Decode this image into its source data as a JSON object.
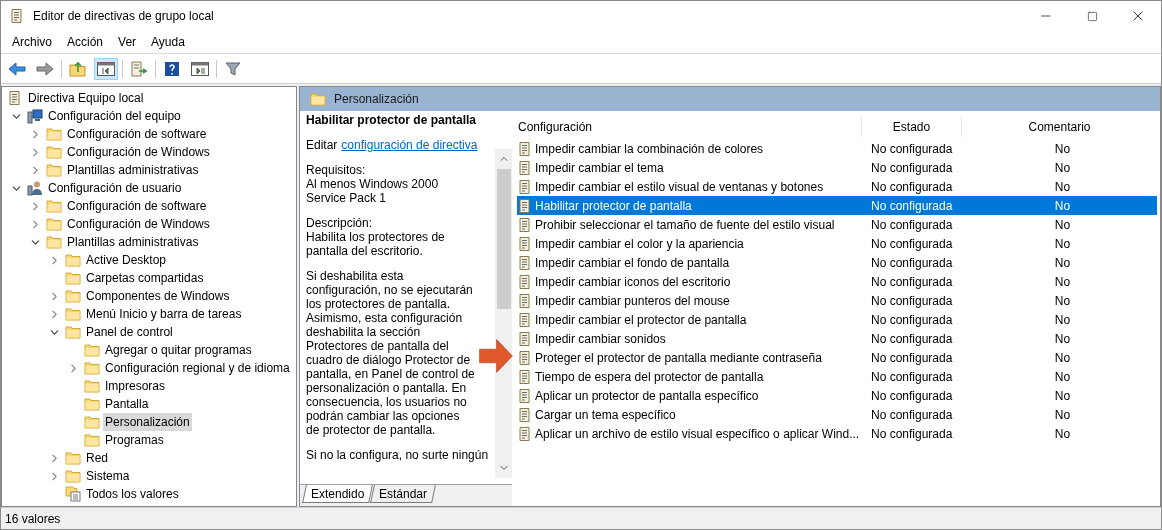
{
  "window": {
    "title": "Editor de directivas de grupo local"
  },
  "menu": [
    "Archivo",
    "Acción",
    "Ver",
    "Ayuda"
  ],
  "tree": [
    {
      "label": "Directiva Equipo local",
      "kind": "document",
      "selected": false,
      "children": [
        {
          "label": "Configuración del equipo",
          "kind": "computer",
          "expanded": true,
          "selected": false,
          "children": [
            {
              "label": "Configuración de software",
              "kind": "folder",
              "expanded": false,
              "selected": false
            },
            {
              "label": "Configuración de Windows",
              "kind": "folder",
              "expanded": false,
              "selected": false
            },
            {
              "label": "Plantillas administrativas",
              "kind": "folder",
              "expanded": false,
              "selected": false
            }
          ]
        },
        {
          "label": "Configuración de usuario",
          "kind": "user",
          "expanded": true,
          "selected": false,
          "children": [
            {
              "label": "Configuración de software",
              "kind": "folder",
              "expanded": false,
              "selected": false
            },
            {
              "label": "Configuración de Windows",
              "kind": "folder",
              "expanded": false,
              "selected": false
            },
            {
              "label": "Plantillas administrativas",
              "kind": "folder",
              "expanded": true,
              "selected": false,
              "children": [
                {
                  "label": "Active Desktop",
                  "kind": "folder",
                  "expanded": false,
                  "selected": false
                },
                {
                  "label": "Carpetas compartidas",
                  "kind": "folder",
                  "selected": false
                },
                {
                  "label": "Componentes de Windows",
                  "kind": "folder",
                  "expanded": false,
                  "selected": false
                },
                {
                  "label": "Menú Inicio y barra de tareas",
                  "kind": "folder",
                  "expanded": false,
                  "selected": false
                },
                {
                  "label": "Panel de control",
                  "kind": "folder",
                  "expanded": true,
                  "selected": false,
                  "children": [
                    {
                      "label": "Agregar o quitar programas",
                      "kind": "folder",
                      "selected": false
                    },
                    {
                      "label": "Configuración regional y de idioma",
                      "kind": "folder",
                      "expanded": false,
                      "selected": false
                    },
                    {
                      "label": "Impresoras",
                      "kind": "folder",
                      "selected": false
                    },
                    {
                      "label": "Pantalla",
                      "kind": "folder",
                      "selected": false
                    },
                    {
                      "label": "Personalización",
                      "kind": "folder",
                      "selected": true
                    },
                    {
                      "label": "Programas",
                      "kind": "folder",
                      "selected": false
                    }
                  ]
                },
                {
                  "label": "Red",
                  "kind": "folder",
                  "expanded": false,
                  "selected": false
                },
                {
                  "label": "Sistema",
                  "kind": "folder",
                  "expanded": false,
                  "selected": false
                },
                {
                  "label": "Todos los valores",
                  "kind": "all",
                  "selected": false
                }
              ]
            }
          ]
        }
      ]
    }
  ],
  "header": {
    "title": "Personalización"
  },
  "description": {
    "title": "Habilitar protector de pantalla",
    "edit_prefix": "Editar",
    "edit_link": "configuración de directiva",
    "paragraphs": [
      "Requisitos:\nAl menos Windows 2000 Service Pack 1",
      "Descripción:\nHabilita los protectores de pantalla del escritorio.",
      "Si deshabilita esta configuración, no se ejecutarán los protectores de pantalla. Asimismo, esta configuración deshabilita la sección Protectores de pantalla del cuadro de diálogo Protector de pantalla, en Panel de control de personalización o pantalla. En consecuencia, los usuarios no podrán cambiar las opciones de protector de pantalla.",
      "Si no la configura, no surte ningún"
    ]
  },
  "table": {
    "columns": [
      "Configuración",
      "Estado",
      "Comentario"
    ],
    "rows": [
      {
        "name": "Impedir cambiar la combinación de colores",
        "state": "No configurada",
        "comment": "No",
        "selected": false
      },
      {
        "name": "Impedir cambiar el tema",
        "state": "No configurada",
        "comment": "No",
        "selected": false
      },
      {
        "name": "Impedir cambiar el estilo visual de ventanas y botones",
        "state": "No configurada",
        "comment": "No",
        "selected": false
      },
      {
        "name": "Habilitar protector de pantalla",
        "state": "No configurada",
        "comment": "No",
        "selected": true
      },
      {
        "name": "Prohibir seleccionar el tamaño de fuente del estilo visual",
        "state": "No configurada",
        "comment": "No",
        "selected": false
      },
      {
        "name": "Impedir cambiar el color y la apariencia",
        "state": "No configurada",
        "comment": "No",
        "selected": false
      },
      {
        "name": "Impedir cambiar el fondo de pantalla",
        "state": "No configurada",
        "comment": "No",
        "selected": false
      },
      {
        "name": "Impedir cambiar iconos del escritorio",
        "state": "No configurada",
        "comment": "No",
        "selected": false
      },
      {
        "name": "Impedir cambiar punteros del mouse",
        "state": "No configurada",
        "comment": "No",
        "selected": false
      },
      {
        "name": "Impedir cambiar el protector de pantalla",
        "state": "No configurada",
        "comment": "No",
        "selected": false
      },
      {
        "name": "Impedir cambiar sonidos",
        "state": "No configurada",
        "comment": "No",
        "selected": false
      },
      {
        "name": "Proteger el protector de pantalla mediante contraseña",
        "state": "No configurada",
        "comment": "No",
        "selected": false
      },
      {
        "name": "Tiempo de espera del protector de pantalla",
        "state": "No configurada",
        "comment": "No",
        "selected": false
      },
      {
        "name": "Aplicar un protector de pantalla específico",
        "state": "No configurada",
        "comment": "No",
        "selected": false
      },
      {
        "name": "Cargar un tema específico",
        "state": "No configurada",
        "comment": "No",
        "selected": false
      },
      {
        "name": "Aplicar un archivo de estilo visual específico o aplicar Wind...",
        "state": "No configurada",
        "comment": "No",
        "selected": false
      }
    ]
  },
  "tabs": [
    {
      "label": "Extendido",
      "selected": true
    },
    {
      "label": "Estándar",
      "selected": false
    }
  ],
  "status_bar": "16 valores"
}
